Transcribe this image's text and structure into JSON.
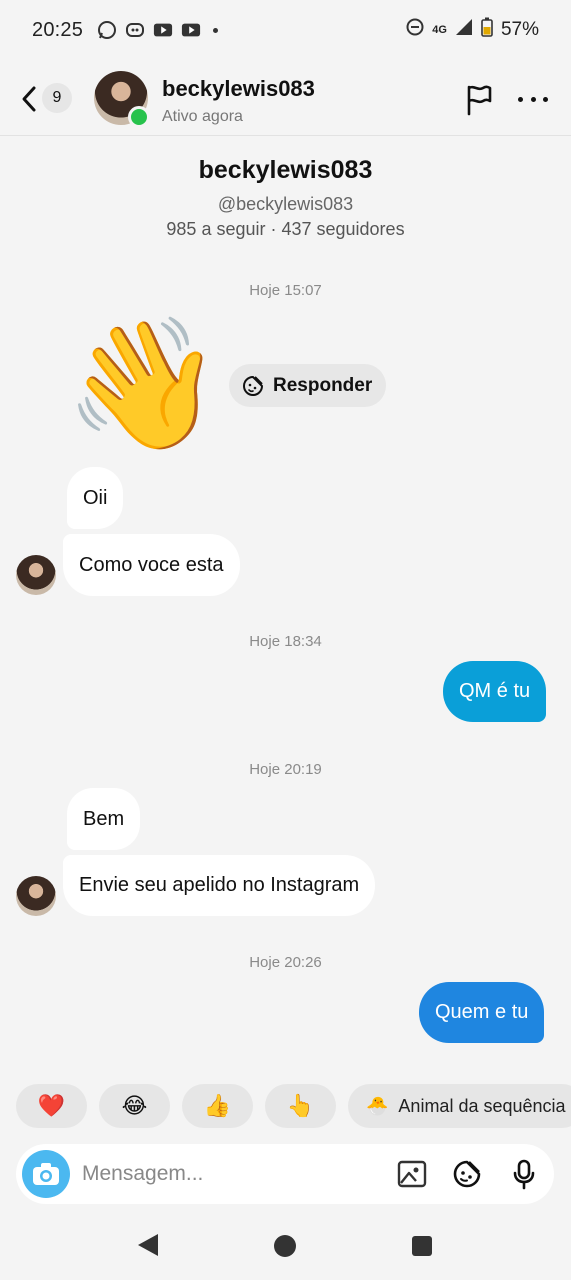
{
  "status_bar": {
    "time": "20:25",
    "network": "4G",
    "battery": "57%"
  },
  "header": {
    "unread_count": "9",
    "username": "beckylewis083",
    "active_status": "Ativo agora"
  },
  "profile": {
    "name": "beckylewis083",
    "handle": "@beckylewis083",
    "stats": "985 a seguir · 437 seguidores"
  },
  "thread": {
    "ts1": "Hoje 15:07",
    "wave": "👋",
    "reply_label": "Responder",
    "msg_oii": "Oii",
    "msg_como": "Como voce esta",
    "ts2": "Hoje 18:34",
    "msg_qm": "QM é tu",
    "ts3": "Hoje 20:19",
    "msg_bem": "Bem",
    "msg_envie": "Envie seu apelido no Instagram",
    "ts4": "Hoje 20:26",
    "msg_quem": "Quem e tu"
  },
  "quick_replies": {
    "heart": "❤️",
    "laugh": "😂",
    "thumbs": "👍",
    "point": "👆",
    "animal_emoji": "🐣",
    "animal_label": "Animal da sequência"
  },
  "composer": {
    "placeholder": "Mensagem..."
  },
  "colors": {
    "outgoing_bubble_1": "#0a9fd8",
    "outgoing_bubble_2": "#1f86e0",
    "online": "#27c24c",
    "camera": "#4bb8f0"
  }
}
